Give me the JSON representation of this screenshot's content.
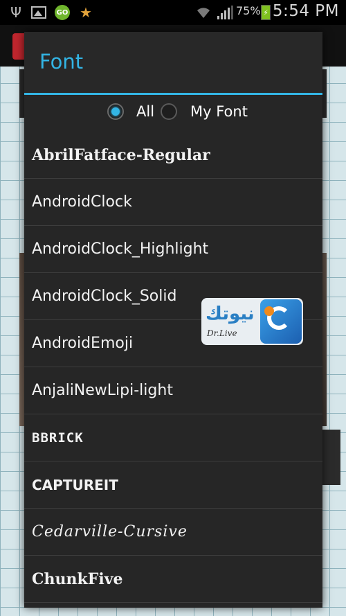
{
  "status_bar": {
    "battery_percent": "75%",
    "time": "5:54 PM",
    "icons": [
      "usb-icon",
      "image-icon",
      "go-launcher-icon",
      "star-icon",
      "wifi-icon",
      "signal-icon",
      "battery-charging-icon"
    ]
  },
  "dialog": {
    "title": "Font",
    "filter": {
      "options": [
        {
          "label": "All",
          "selected": true
        },
        {
          "label": "My Font",
          "selected": false
        }
      ]
    },
    "fonts": [
      "AbrilFatface-Regular",
      "AndroidClock",
      "AndroidClock_Highlight",
      "AndroidClock_Solid",
      "AndroidEmoji",
      "AnjaliNewLipi-light",
      "BBRICK",
      "CAPTUREIT",
      "Cedarville-Cursive",
      "ChunkFive"
    ]
  },
  "colors": {
    "accent": "#33b5e5",
    "dialog_bg": "#262626",
    "divider": "#3d3d3d"
  },
  "watermark": {
    "text": "نيوتك",
    "subtext": "Dr.Live"
  }
}
